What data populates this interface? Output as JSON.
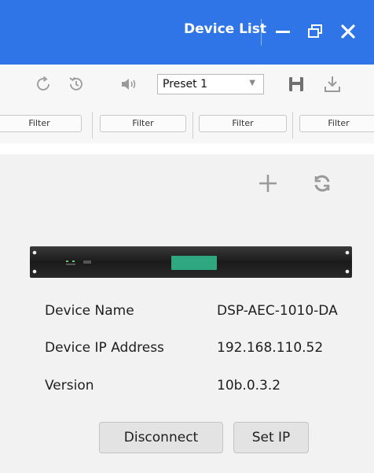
{
  "window": {
    "title": "Device List",
    "controls": [
      "minimize-icon",
      "restore-icon",
      "close-icon"
    ]
  },
  "toolbar": {
    "icons": [
      "refresh-icon",
      "history-icon",
      "volume-icon",
      "save-icon",
      "download-icon"
    ],
    "preset_value": "Preset 1"
  },
  "filters": [
    {
      "label": "Filter"
    },
    {
      "label": "Filter"
    },
    {
      "label": "Filter"
    },
    {
      "label": "Filter"
    }
  ],
  "panel": {
    "actions": [
      "add-icon",
      "sync-icon"
    ],
    "device": {
      "name_label": "Device Name",
      "name_value": "DSP-AEC-1010-DA",
      "ip_label": "Device IP Address",
      "ip_value": "192.168.110.52",
      "version_label": "Version",
      "version_value": "10b.0.3.2"
    },
    "disconnect_label": "Disconnect",
    "set_ip_label": "Set IP"
  },
  "colors": {
    "title_bar": "#2f75e8",
    "panel_bg": "#f2f2f2",
    "device_screen": "#2fa882"
  }
}
